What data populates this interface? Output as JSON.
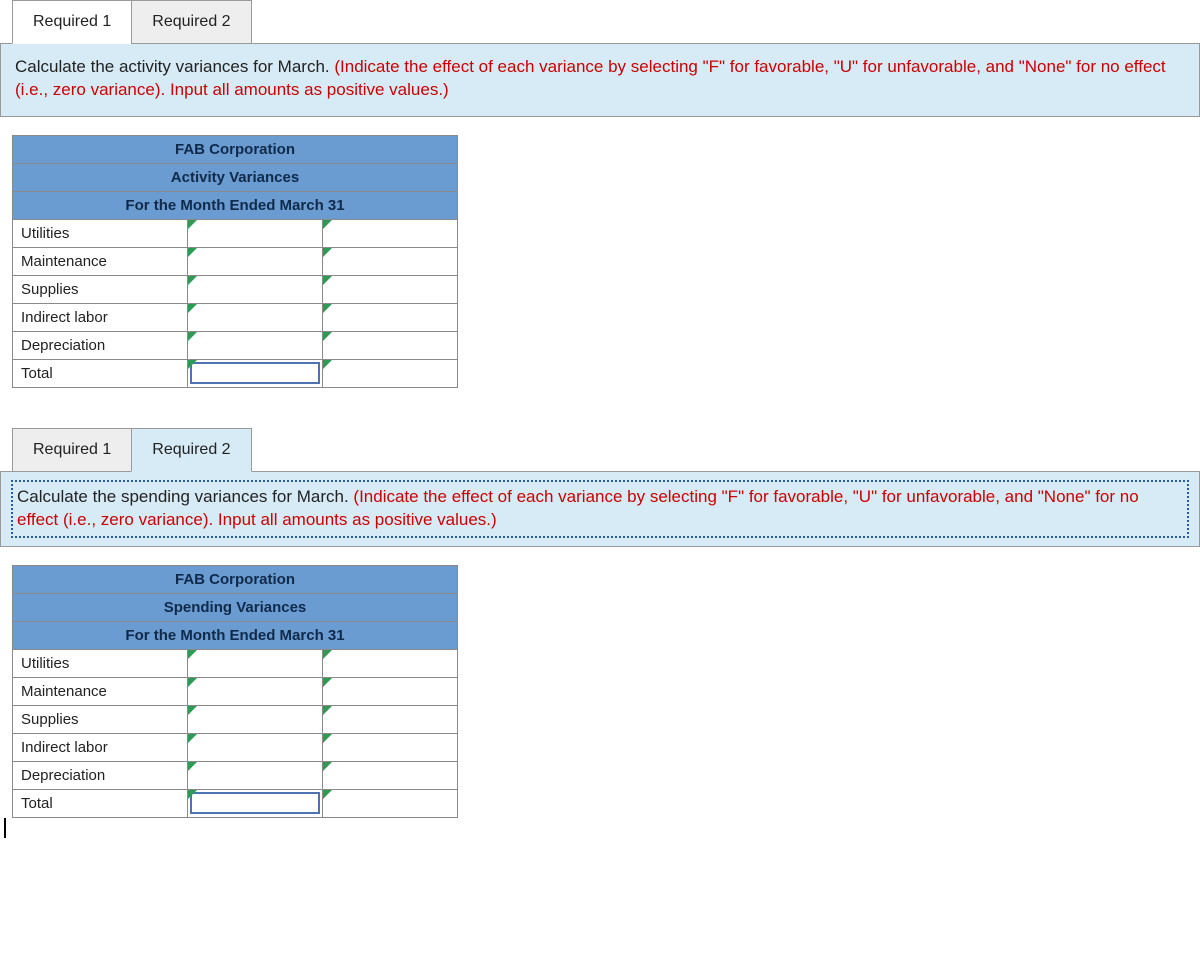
{
  "sections": [
    {
      "tabs": [
        "Required 1",
        "Required 2"
      ],
      "active_tab_index": 0,
      "tab_style": "white",
      "instruction_black": "Calculate the activity variances for March. ",
      "instruction_red": "(Indicate the effect of each variance by selecting \"F\" for favorable, \"U\" for unfavorable, and \"None\" for no effect (i.e., zero variance). Input all amounts as positive values.)",
      "dotted": false,
      "table": {
        "header1": "FAB Corporation",
        "header2": "Activity Variances",
        "header3": "For the Month Ended March 31",
        "rows": [
          "Utilities",
          "Maintenance",
          "Supplies",
          "Indirect labor",
          "Depreciation",
          "Total"
        ]
      }
    },
    {
      "tabs": [
        "Required 1",
        "Required 2"
      ],
      "active_tab_index": 1,
      "tab_style": "blue",
      "instruction_black": "Calculate the spending variances for March. ",
      "instruction_red": "(Indicate the effect of each variance by selecting \"F\" for favorable, \"U\" for unfavorable, and \"None\" for no effect (i.e., zero variance). Input all amounts as positive values.)",
      "dotted": true,
      "table": {
        "header1": "FAB Corporation",
        "header2": "Spending Variances",
        "header3": "For the Month Ended March 31",
        "rows": [
          "Utilities",
          "Maintenance",
          "Supplies",
          "Indirect labor",
          "Depreciation",
          "Total"
        ]
      }
    }
  ]
}
